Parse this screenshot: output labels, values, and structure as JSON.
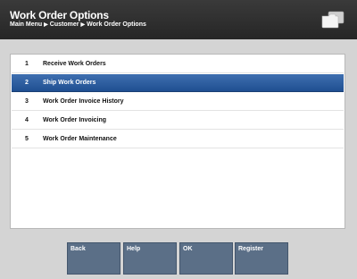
{
  "header": {
    "title": "Work Order Options",
    "breadcrumb": [
      "Main Menu",
      "Customer",
      "Work Order Options"
    ],
    "icon": "folders-icon"
  },
  "menu": {
    "selected_index": 1,
    "items": [
      {
        "num": "1",
        "label": "Receive Work Orders"
      },
      {
        "num": "2",
        "label": "Ship Work Orders"
      },
      {
        "num": "3",
        "label": "Work Order Invoice History"
      },
      {
        "num": "4",
        "label": "Work Order Invoicing"
      },
      {
        "num": "5",
        "label": "Work Order Maintenance"
      }
    ]
  },
  "buttons": {
    "back": "Back",
    "help": "Help",
    "ok": "OK",
    "register": "Register"
  },
  "colors": {
    "header_bg": "#2f2f2f",
    "selection": "#2a5a9c",
    "button": "#5b6f87",
    "background": "#d4d4d4"
  }
}
